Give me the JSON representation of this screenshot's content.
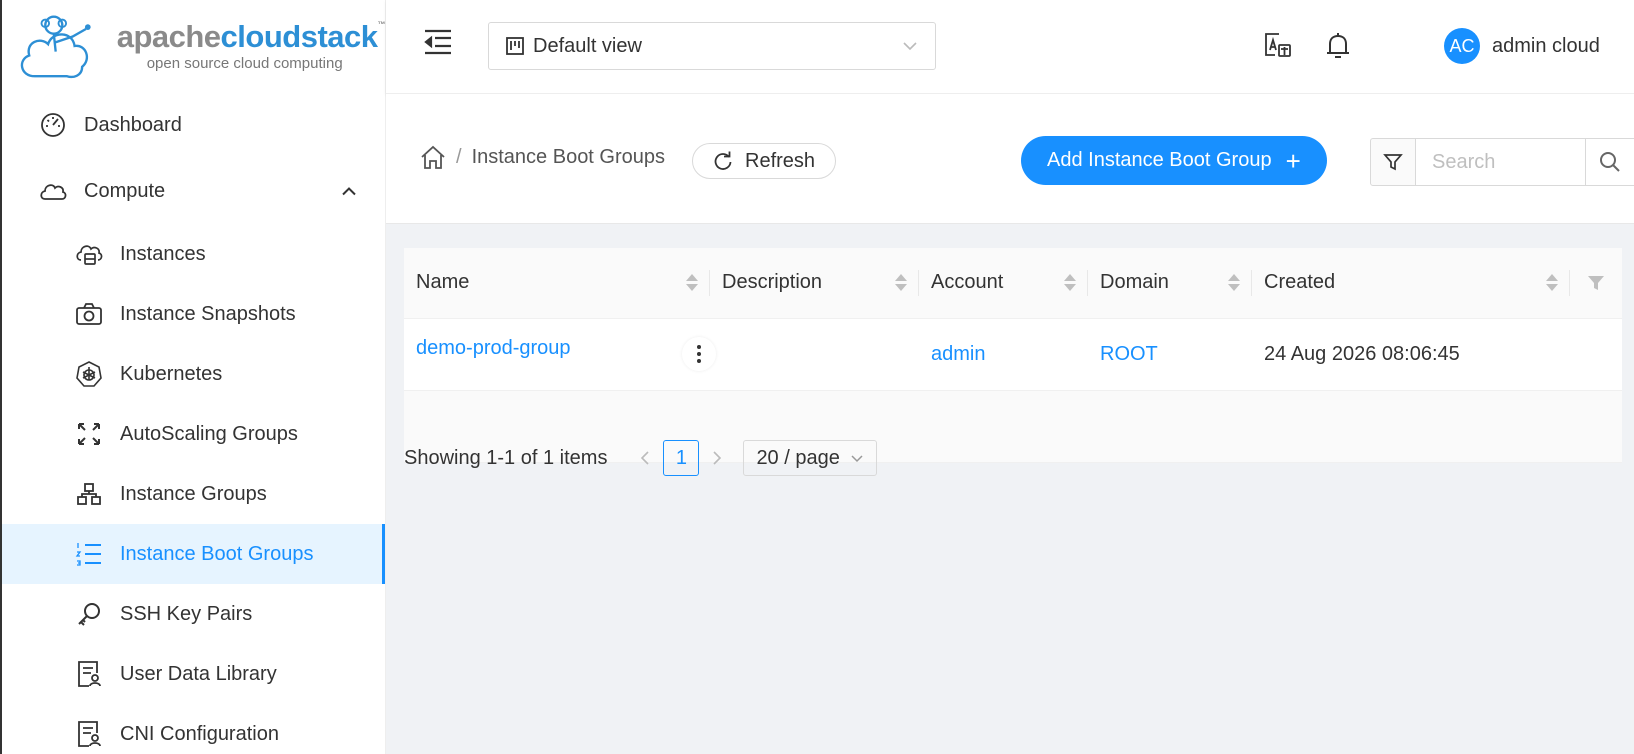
{
  "app": {
    "logo": {
      "name_part1": "apache",
      "name_part2": "cloudstack",
      "trademark": "™",
      "tagline": "open source cloud computing"
    }
  },
  "sidebar": {
    "items": [
      {
        "label": "Dashboard",
        "icon": "dashboard-icon"
      },
      {
        "label": "Compute",
        "icon": "cloud-icon",
        "expanded": true
      },
      {
        "label": "Instances",
        "icon": "cloud-server-icon"
      },
      {
        "label": "Instance Snapshots",
        "icon": "camera-icon"
      },
      {
        "label": "Kubernetes",
        "icon": "kubernetes-icon"
      },
      {
        "label": "AutoScaling Groups",
        "icon": "expand-icon"
      },
      {
        "label": "Instance Groups",
        "icon": "cluster-icon"
      },
      {
        "label": "Instance Boot Groups",
        "icon": "ordered-list-icon",
        "active": true
      },
      {
        "label": "SSH Key Pairs",
        "icon": "key-icon"
      },
      {
        "label": "User Data Library",
        "icon": "user-doc-icon"
      },
      {
        "label": "CNI Configuration",
        "icon": "user-doc-icon"
      }
    ]
  },
  "header": {
    "view_select": "Default view",
    "user": {
      "initials": "AC",
      "name": "admin cloud"
    }
  },
  "page": {
    "breadcrumb_sep": "/",
    "title": "Instance Boot Groups",
    "refresh_label": "Refresh",
    "add_label": "Add Instance Boot Group",
    "add_plus": "+",
    "search_placeholder": "Search"
  },
  "table": {
    "columns": [
      "Name",
      "Description",
      "Account",
      "Domain",
      "Created"
    ],
    "rows": [
      {
        "name": "demo-prod-group",
        "description": "",
        "account": "admin",
        "domain": "ROOT",
        "created": "24 Aug 2026 08:06:45"
      }
    ]
  },
  "pagination": {
    "total_text": "Showing 1-1 of 1 items",
    "current_page": "1",
    "page_size": "20 / page"
  },
  "colors": {
    "primary": "#1890ff",
    "active_bg": "#e6f4ff"
  }
}
